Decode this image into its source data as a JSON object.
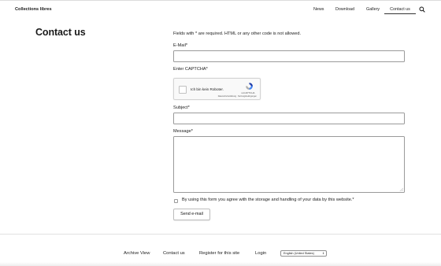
{
  "site": {
    "title": "Collections libres"
  },
  "nav": {
    "items": [
      {
        "label": "News"
      },
      {
        "label": "Download"
      },
      {
        "label": "Gallery"
      },
      {
        "label": "Contact us",
        "active": true
      }
    ],
    "search_icon": "search-icon"
  },
  "page": {
    "title": "Contact us"
  },
  "form": {
    "note": "Fields with * are required. HTML or any other code is not allowed.",
    "email_label": "E-Mail*",
    "email_value": "",
    "captcha_label": "Enter CAPTCHA*",
    "captcha": {
      "checkbox_text": "Ich bin kein Roboter.",
      "brand": "reCAPTCHA",
      "links": "Datenschutzerklärung · Nutzungsbedingungen",
      "logo_icon": "recaptcha-logo-icon"
    },
    "subject_label": "Subject*",
    "subject_value": "",
    "message_label": "Message*",
    "message_value": "",
    "agree_text": "By using this form you agree with the storage and handling of your data by this website.*",
    "submit_label": "Send e-mail"
  },
  "footer": {
    "links": [
      {
        "label": "Archive View"
      },
      {
        "label": "Contact us"
      },
      {
        "label": "Register for this site"
      },
      {
        "label": "Login"
      }
    ],
    "language": "English (United States)"
  },
  "colors": {
    "border": "#9a9a9a",
    "text": "#1a1a1a",
    "background": "#ffffff"
  }
}
